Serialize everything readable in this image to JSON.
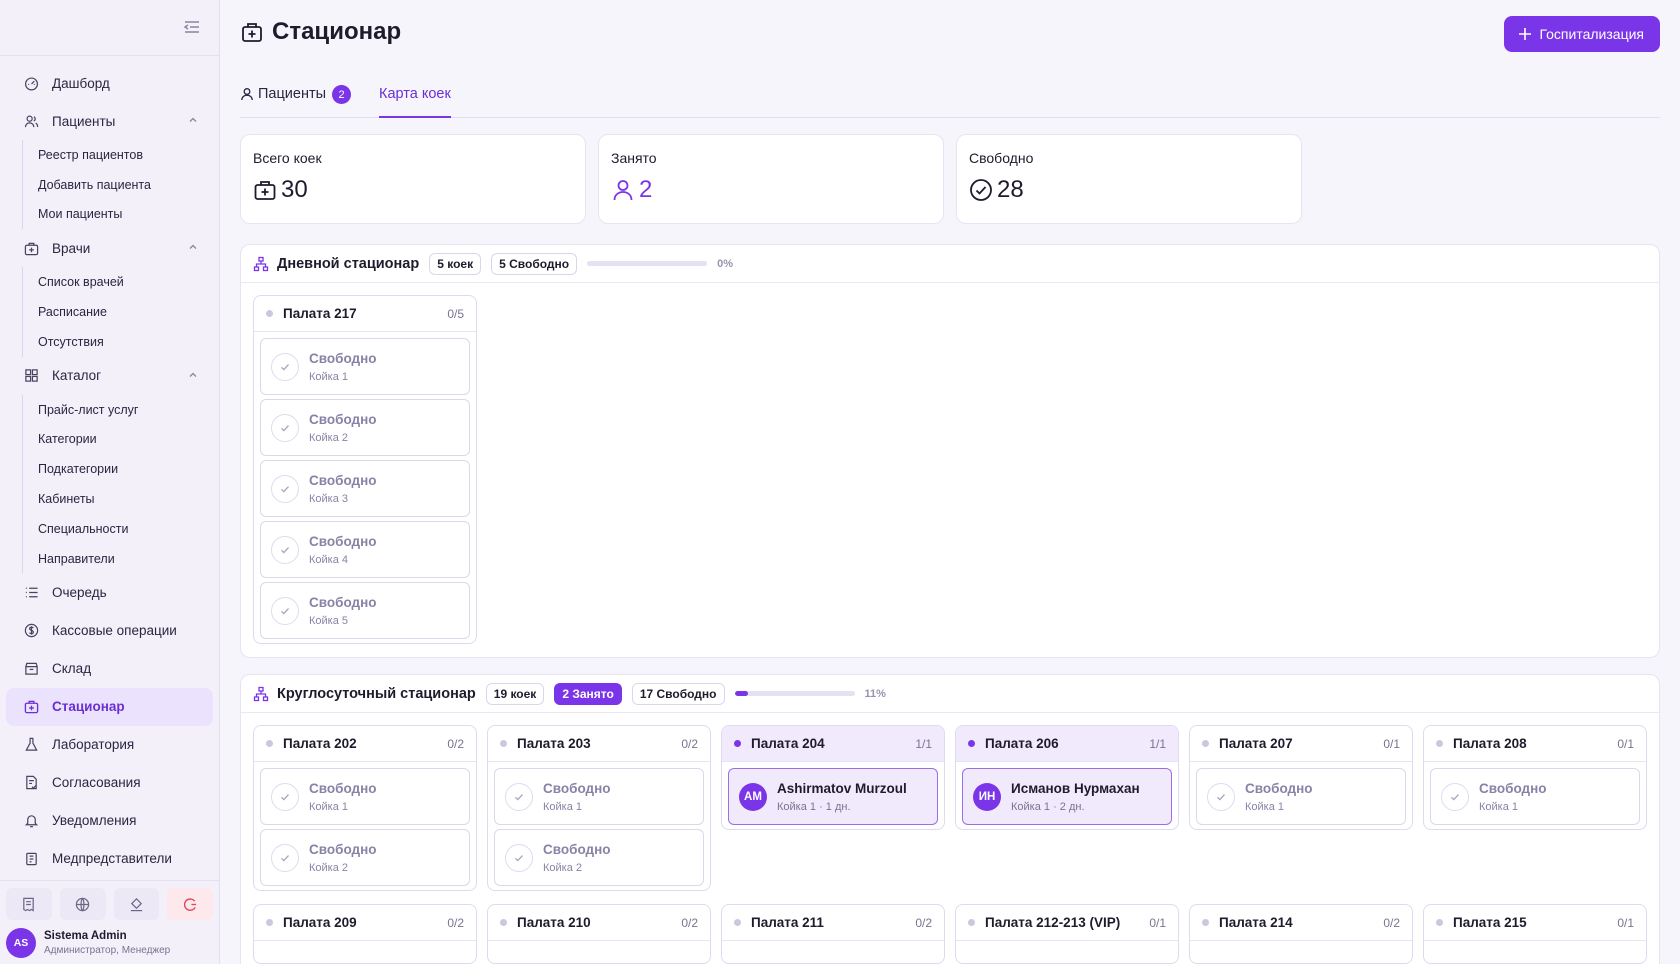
{
  "sidebar": {
    "nav": [
      {
        "label": "Дашборд",
        "icon": "dashboard-icon"
      },
      {
        "label": "Пациенты",
        "icon": "users-icon",
        "sub": [
          "Реестр пациентов",
          "Добавить пациента",
          "Мои пациенты"
        ]
      },
      {
        "label": "Врачи",
        "icon": "medical-bag-icon",
        "sub": [
          "Список врачей",
          "Расписание",
          "Отсутствия"
        ]
      },
      {
        "label": "Каталог",
        "icon": "grid-icon",
        "sub": [
          "Прайс-лист услуг",
          "Категории",
          "Подкатегории",
          "Кабинеты",
          "Специальности",
          "Направители"
        ]
      },
      {
        "label": "Очередь",
        "icon": "list-icon"
      },
      {
        "label": "Кассовые операции",
        "icon": "dollar-icon"
      },
      {
        "label": "Склад",
        "icon": "archive-icon"
      },
      {
        "label": "Стационар",
        "icon": "hospital-icon"
      },
      {
        "label": "Лаборатория",
        "icon": "flask-icon"
      },
      {
        "label": "Согласования",
        "icon": "document-check-icon"
      },
      {
        "label": "Уведомления",
        "icon": "bell-icon"
      },
      {
        "label": "Медпредставители",
        "icon": "clipboard-icon"
      }
    ],
    "active": "Стационар",
    "user": {
      "initials": "AS",
      "name": "Sistema Admin",
      "role": "Администратор, Менеджер"
    }
  },
  "header": {
    "title": "Стационар",
    "action_label": "Госпитализация"
  },
  "tabs": {
    "patients_label": "Пациенты",
    "patients_count": "2",
    "beds_label": "Карта коек"
  },
  "stats": {
    "total": {
      "label": "Всего коек",
      "value": "30"
    },
    "occupied": {
      "label": "Занято",
      "value": "2"
    },
    "free": {
      "label": "Свободно",
      "value": "28"
    }
  },
  "colors": {
    "accent": "#7b35e8",
    "accent_light": "#f1eafd"
  },
  "departments": [
    {
      "name": "Дневной стационар",
      "beds_label": "5 коек",
      "occupied_label": "",
      "free_label": "5 Свободно",
      "occupancy": 0,
      "pct_label": "0%",
      "rooms": [
        {
          "name": "Палата 217",
          "cap": "0/5",
          "beds": [
            {
              "status": "free",
              "title": "Свободно",
              "sub": "Койка 1"
            },
            {
              "status": "free",
              "title": "Свободно",
              "sub": "Койка 2"
            },
            {
              "status": "free",
              "title": "Свободно",
              "sub": "Койка 3"
            },
            {
              "status": "free",
              "title": "Свободно",
              "sub": "Койка 4"
            },
            {
              "status": "free",
              "title": "Свободно",
              "sub": "Койка 5"
            }
          ]
        }
      ]
    },
    {
      "name": "Круглосуточный стационар",
      "beds_label": "19 коек",
      "occupied_label": "2 Занято",
      "free_label": "17 Свободно",
      "occupancy": 0.11,
      "pct_label": "11%",
      "rooms": [
        {
          "name": "Палата 202",
          "cap": "0/2",
          "beds": [
            {
              "status": "free",
              "title": "Свободно",
              "sub": "Койка 1"
            },
            {
              "status": "free",
              "title": "Свободно",
              "sub": "Койка 2"
            }
          ]
        },
        {
          "name": "Палата 203",
          "cap": "0/2",
          "beds": [
            {
              "status": "free",
              "title": "Свободно",
              "sub": "Койка 1"
            },
            {
              "status": "free",
              "title": "Свободно",
              "sub": "Койка 2"
            }
          ]
        },
        {
          "name": "Палата 204",
          "cap": "1/1",
          "beds": [
            {
              "status": "occupied",
              "initials": "AM",
              "title": "Ashirmatov Murzoul",
              "sub": "Койка 1 · 1 дн."
            }
          ]
        },
        {
          "name": "Палата 206",
          "cap": "1/1",
          "beds": [
            {
              "status": "occupied",
              "initials": "ИН",
              "title": "Исманов Нурмахан",
              "sub": "Койка 1 · 2 дн."
            }
          ]
        },
        {
          "name": "Палата 207",
          "cap": "0/1",
          "beds": [
            {
              "status": "free",
              "title": "Свободно",
              "sub": "Койка 1"
            }
          ]
        },
        {
          "name": "Палата 208",
          "cap": "0/1",
          "beds": [
            {
              "status": "free",
              "title": "Свободно",
              "sub": "Койка 1"
            }
          ]
        },
        {
          "name": "Палата 209",
          "cap": "0/2",
          "beds": []
        },
        {
          "name": "Палата 210",
          "cap": "0/2",
          "beds": []
        },
        {
          "name": "Палата 211",
          "cap": "0/2",
          "beds": []
        },
        {
          "name": "Палата 212-213 (VIP)",
          "cap": "0/1",
          "beds": []
        },
        {
          "name": "Палата 214",
          "cap": "0/2",
          "beds": []
        },
        {
          "name": "Палата 215",
          "cap": "0/1",
          "beds": []
        }
      ]
    }
  ]
}
